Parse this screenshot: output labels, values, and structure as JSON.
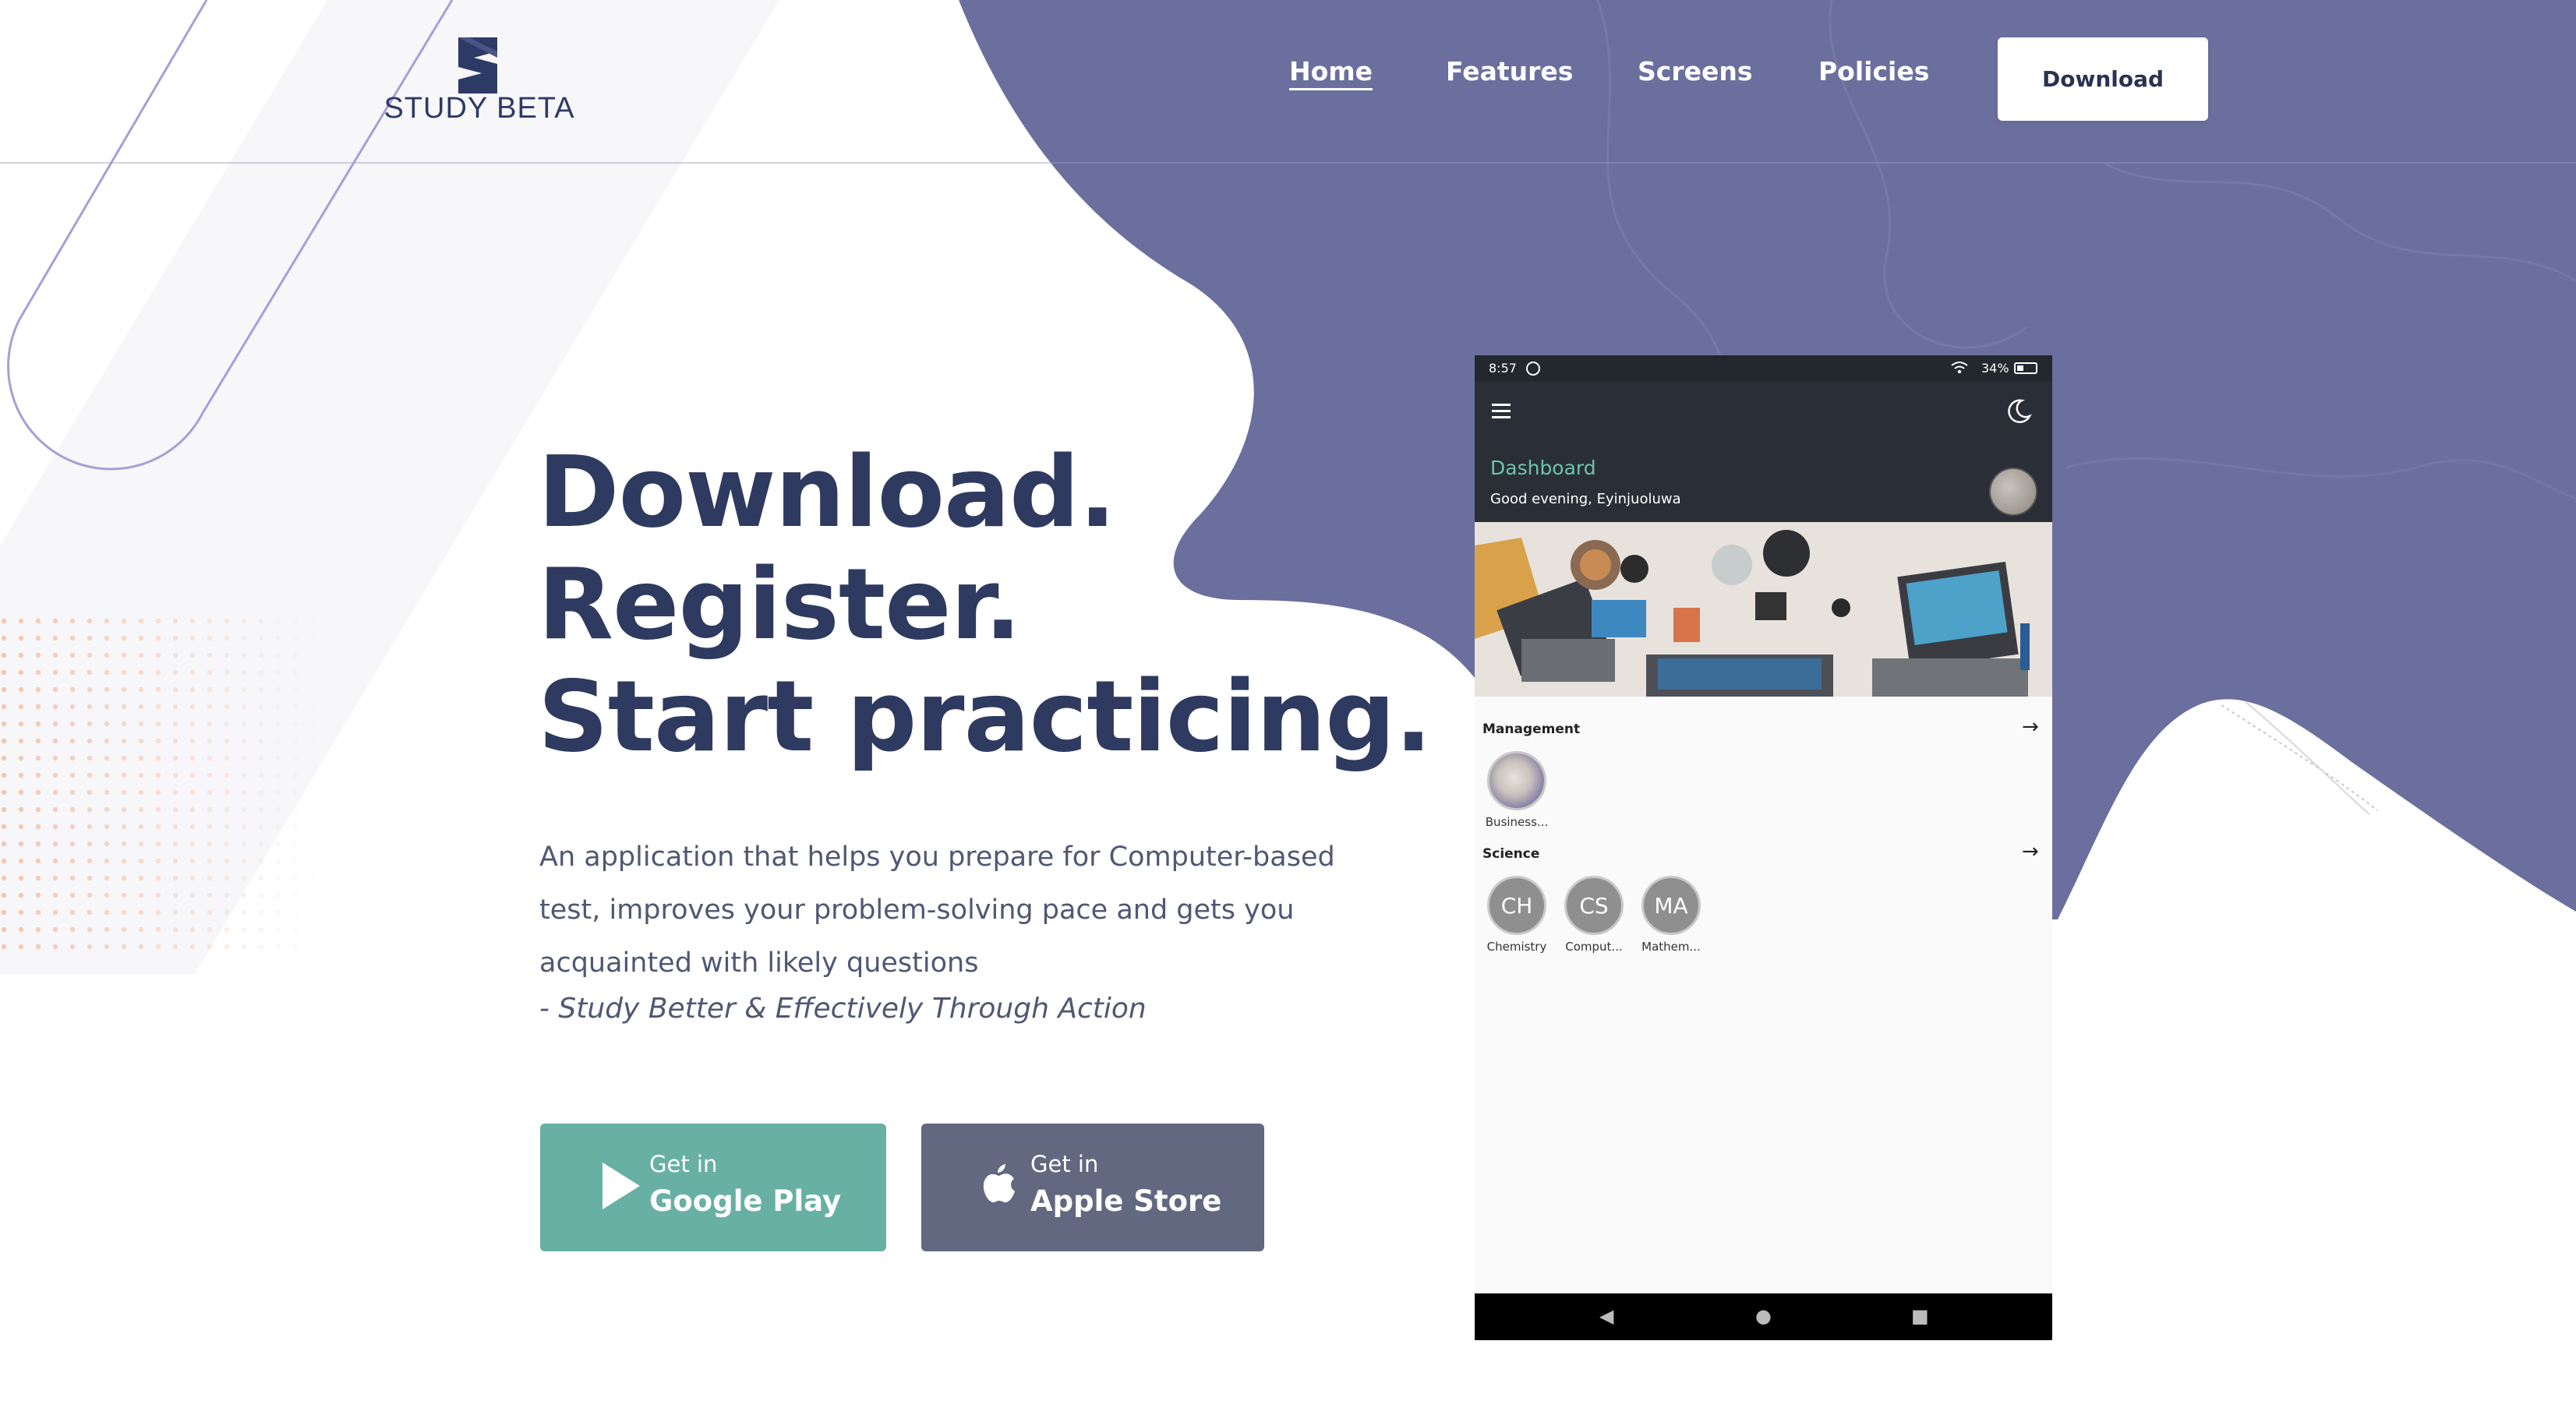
{
  "brand": {
    "name": "STUDY BETA",
    "colors": {
      "accent_purple": "#5f6396",
      "dark_navy": "#2e3a5f",
      "google_green": "#68b0a4",
      "apple_gray": "#626880",
      "dashboard_teal": "#6cc4a9"
    }
  },
  "nav": {
    "items": [
      {
        "label": "Home",
        "active": true
      },
      {
        "label": "Features",
        "active": false
      },
      {
        "label": "Screens",
        "active": false
      },
      {
        "label": "Policies",
        "active": false
      }
    ],
    "download_label": "Download"
  },
  "hero": {
    "headline": [
      "Download.",
      "Register.",
      "Start practicing."
    ],
    "description_lines": [
      "An application that helps you prepare for Computer-based",
      "test, improves your problem-solving pace and gets you",
      "acquainted with likely questions"
    ],
    "tagline": "- Study Better & Effectively Through Action",
    "buttons": {
      "google": {
        "small": "Get in",
        "big": "Google Play",
        "icon": "play-icon"
      },
      "apple": {
        "small": "Get in",
        "big": "Apple Store",
        "icon": "apple-icon"
      }
    }
  },
  "phone": {
    "status": {
      "time": "8:57",
      "battery": "34%"
    },
    "app_title": "Dashboard",
    "greeting": "Good evening, Eyinjuoluwa",
    "sections": [
      {
        "title": "Management",
        "items": [
          {
            "initials": "",
            "label": "Business..."
          }
        ]
      },
      {
        "title": "Science",
        "items": [
          {
            "initials": "CH",
            "label": "Chemistry"
          },
          {
            "initials": "CS",
            "label": "Comput..."
          },
          {
            "initials": "MA",
            "label": "Mathem..."
          }
        ]
      }
    ],
    "nav_buttons": [
      "◀",
      "●",
      "■"
    ]
  }
}
